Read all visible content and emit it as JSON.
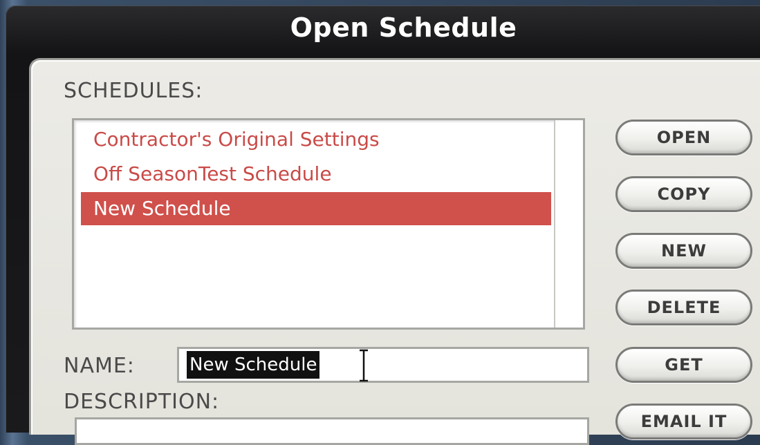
{
  "dialog": {
    "title": "Open Schedule"
  },
  "schedules": {
    "label": "SCHEDULES:",
    "items": [
      {
        "label": "Contractor's Original Settings",
        "selected": false
      },
      {
        "label": "Off SeasonTest Schedule",
        "selected": false
      },
      {
        "label": "New Schedule",
        "selected": true
      }
    ]
  },
  "name": {
    "label": "NAME:",
    "value": "New Schedule"
  },
  "description": {
    "label": "DESCRIPTION:"
  },
  "buttons": {
    "open": "OPEN",
    "copy": "COPY",
    "new": "NEW",
    "delete": "DELETE",
    "get": "GET",
    "email": "EMAIL IT"
  },
  "colors": {
    "selection": "#d0504b",
    "item_text": "#c94a47",
    "panel": "#ecebe6",
    "frame": "#141416"
  },
  "icons": {
    "text_cursor": "i-beam-cursor-icon"
  }
}
